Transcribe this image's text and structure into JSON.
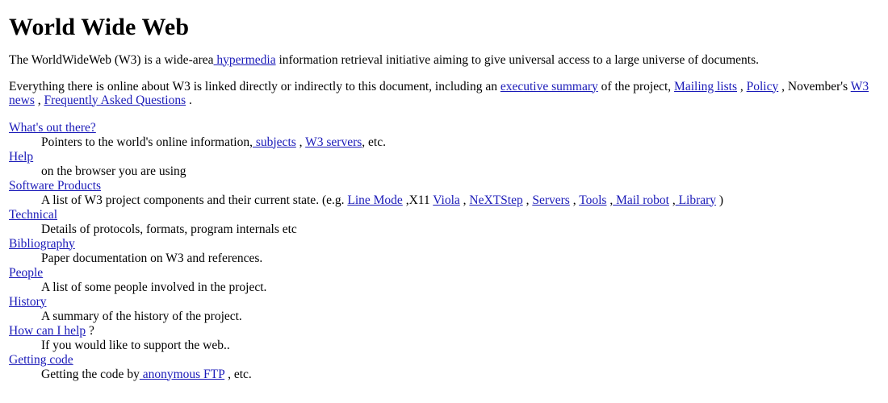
{
  "document": {
    "title": "World Wide Web",
    "link_color": "#1a1aB8",
    "text_color": "#000000",
    "background_color": "#ffffff"
  },
  "intro": {
    "p1_a": "The WorldWideWeb (W3) is a wide-area",
    "p1_link_hypermedia": " hypermedia",
    "p1_b": " information retrieval initiative aiming to give universal access to a large universe of documents.",
    "p2_a": "Everything there is online about W3 is linked directly or indirectly to this document, including an ",
    "p2_link_exec": "executive summary",
    "p2_b": " of the project, ",
    "p2_link_mailing": "Mailing lists",
    "p2_c": " , ",
    "p2_link_policy": "Policy",
    "p2_d": " , November's ",
    "p2_link_news": "W3 news",
    "p2_e": " , ",
    "p2_link_faq": "Frequently Asked Questions",
    "p2_f": " ."
  },
  "index": {
    "items": [
      {
        "term_link": "What's out there?",
        "term_suffix": "",
        "desc_a": "Pointers to the world's online information,",
        "desc_link1": " subjects",
        "desc_b": " , ",
        "desc_link2": "W3 servers",
        "desc_c": ", etc."
      },
      {
        "term_link": "Help",
        "term_suffix": "",
        "desc_a": "on the browser you are using",
        "desc_link1": "",
        "desc_b": "",
        "desc_link2": "",
        "desc_c": ""
      },
      {
        "term_link": "Software Products",
        "term_suffix": "",
        "desc_a": "A list of W3 project components and their current state. (e.g. ",
        "desc_links": [
          {
            "text": "Line Mode",
            "sep": " ,X11 "
          },
          {
            "text": "Viola",
            "sep": " , "
          },
          {
            "text": "NeXTStep",
            "sep": " , "
          },
          {
            "text": "Servers",
            "sep": " , "
          },
          {
            "text": "Tools",
            "sep": " ,"
          },
          {
            "text": " Mail robot",
            "sep": " ,"
          },
          {
            "text": " Library",
            "sep": " )"
          }
        ],
        "desc_c": ""
      },
      {
        "term_link": "Technical",
        "term_suffix": "",
        "desc_a": "Details of protocols, formats, program internals etc",
        "desc_link1": "",
        "desc_b": "",
        "desc_link2": "",
        "desc_c": ""
      },
      {
        "term_link": "Bibliography",
        "term_suffix": "",
        "desc_a": "Paper documentation on W3 and references.",
        "desc_link1": "",
        "desc_b": "",
        "desc_link2": "",
        "desc_c": ""
      },
      {
        "term_link": "People",
        "term_suffix": "",
        "desc_a": "A list of some people involved in the project.",
        "desc_link1": "",
        "desc_b": "",
        "desc_link2": "",
        "desc_c": ""
      },
      {
        "term_link": "History",
        "term_suffix": "",
        "desc_a": "A summary of the history of the project.",
        "desc_link1": "",
        "desc_b": "",
        "desc_link2": "",
        "desc_c": ""
      },
      {
        "term_link": "How can I help",
        "term_suffix": " ?",
        "desc_a": "If you would like to support the web..",
        "desc_link1": "",
        "desc_b": "",
        "desc_link2": "",
        "desc_c": ""
      },
      {
        "term_link": "Getting code",
        "term_suffix": "",
        "desc_a": "Getting the code by",
        "desc_link1": " anonymous FTP",
        "desc_b": " , etc.",
        "desc_link2": "",
        "desc_c": ""
      }
    ]
  }
}
